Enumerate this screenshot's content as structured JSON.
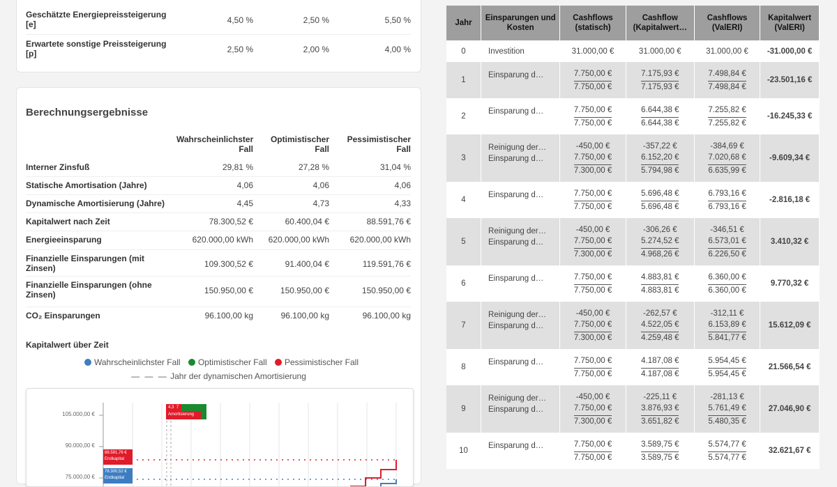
{
  "params": {
    "rows": [
      {
        "label": "Geschätzte Energiepreissteigerung [e]",
        "values": [
          "4,50 %",
          "2,50 %",
          "5,50 %"
        ]
      },
      {
        "label": "Erwartete sonstige Preissteigerung [p]",
        "values": [
          "2,50 %",
          "2,00 %",
          "4,00 %"
        ]
      }
    ]
  },
  "results": {
    "title": "Berechnungsergebnisse",
    "headers": [
      "Wahrscheinlichster Fall",
      "Optimistischer Fall",
      "Pessimistischer Fall"
    ],
    "rows": [
      {
        "label": "Interner Zinsfuß",
        "values": [
          "29,81 %",
          "27,28 %",
          "31,04 %"
        ]
      },
      {
        "label": "Statische Amortisation (Jahre)",
        "values": [
          "4,06",
          "4,06",
          "4,06"
        ]
      },
      {
        "label": "Dynamische Amortisierung (Jahre)",
        "values": [
          "4,45",
          "4,73",
          "4,33"
        ]
      },
      {
        "label": "Kapitalwert nach Zeit",
        "values": [
          "78.300,52 €",
          "60.400,04 €",
          "88.591,76 €"
        ]
      },
      {
        "label": "Energieeinsparung",
        "values": [
          "620.000,00 kWh",
          "620.000,00 kWh",
          "620.000,00 kWh"
        ]
      },
      {
        "label": "Finanzielle Einsparungen (mit Zinsen)",
        "values": [
          "109.300,52 €",
          "91.400,04 €",
          "119.591,76 €"
        ]
      },
      {
        "label": "Finanzielle Einsparungen (ohne Zinsen)",
        "values": [
          "150.950,00 €",
          "150.950,00 €",
          "150.950,00 €"
        ]
      },
      {
        "label": "CO₂ Einsparungen",
        "values": [
          "96.100,00 kg",
          "96.100,00 kg",
          "96.100,00 kg"
        ]
      }
    ]
  },
  "chart": {
    "title": "Kapitalwert über Zeit",
    "legend": [
      {
        "label": "Wahrscheinlichster Fall",
        "color": "#3d7ec3"
      },
      {
        "label": "Optimistischer Fall",
        "color": "#1a8a2e"
      },
      {
        "label": "Pessimistischer Fall",
        "color": "#e01b2a"
      }
    ],
    "legend_dash": "Jahr der dynamischen Amortisierung",
    "y_ticks": [
      "105.000,00 €",
      "90.000,00 €",
      "75.000,00 €"
    ],
    "flags": {
      "red_value": "88.591,76 €",
      "red_label": "Endkapital",
      "blue_value": "78.300,52 €",
      "blue_label": "Endkapital",
      "amort_label": "Amortisierung",
      "amort_year_red": "4,3",
      "amort_year_green": "7"
    }
  },
  "chart_data": {
    "type": "line",
    "title": "Kapitalwert über Zeit",
    "xlabel": "",
    "ylabel": "",
    "y_ticks": [
      105000,
      90000,
      75000
    ],
    "series": [
      {
        "name": "Wahrscheinlichster Fall",
        "final_value": 78300.52
      },
      {
        "name": "Optimistischer Fall",
        "final_value": 60400.04
      },
      {
        "name": "Pessimistischer Fall",
        "final_value": 88591.76
      }
    ],
    "legend": "top"
  },
  "cashflow": {
    "headers": [
      "Jahr",
      "Einsparungen und Kosten",
      "Cashflows (statisch)",
      "Cashflow (Kapitalwert…",
      "Cashflows (ValERI)",
      "Kapitalwert (ValERI)"
    ],
    "rows": [
      {
        "year": "0",
        "desc": [
          "Investition"
        ],
        "s": [
          "31.000,00 €"
        ],
        "k": [
          "31.000,00 €"
        ],
        "v": [
          "31.000,00 €"
        ],
        "kw": "-31.000,00 €",
        "neg": true,
        "single": true
      },
      {
        "year": "1",
        "desc": [
          "Einsparung d…"
        ],
        "s": [
          "7.750,00 €",
          "7.750,00 €"
        ],
        "k": [
          "7.175,93 €",
          "7.175,93 €"
        ],
        "v": [
          "7.498,84 €",
          "7.498,84 €"
        ],
        "kw": "-23.501,16 €",
        "neg": true
      },
      {
        "year": "2",
        "desc": [
          "Einsparung d…"
        ],
        "s": [
          "7.750,00 €",
          "7.750,00 €"
        ],
        "k": [
          "6.644,38 €",
          "6.644,38 €"
        ],
        "v": [
          "7.255,82 €",
          "7.255,82 €"
        ],
        "kw": "-16.245,33 €",
        "neg": true
      },
      {
        "year": "3",
        "desc": [
          "Reinigung der…",
          "Einsparung d…"
        ],
        "s": [
          "-450,00 €",
          "7.750,00 €",
          "7.300,00 €"
        ],
        "k": [
          "-357,22 €",
          "6.152,20 €",
          "5.794,98 €"
        ],
        "v": [
          "-384,69 €",
          "7.020,68 €",
          "6.635,99 €"
        ],
        "kw": "-9.609,34 €",
        "neg": true
      },
      {
        "year": "4",
        "desc": [
          "Einsparung d…"
        ],
        "s": [
          "7.750,00 €",
          "7.750,00 €"
        ],
        "k": [
          "5.696,48 €",
          "5.696,48 €"
        ],
        "v": [
          "6.793,16 €",
          "6.793,16 €"
        ],
        "kw": "-2.816,18 €",
        "neg": true
      },
      {
        "year": "5",
        "desc": [
          "Reinigung der…",
          "Einsparung d…"
        ],
        "s": [
          "-450,00 €",
          "7.750,00 €",
          "7.300,00 €"
        ],
        "k": [
          "-306,26 €",
          "5.274,52 €",
          "4.968,26 €"
        ],
        "v": [
          "-346,51 €",
          "6.573,01 €",
          "6.226,50 €"
        ],
        "kw": "3.410,32 €",
        "neg": false
      },
      {
        "year": "6",
        "desc": [
          "Einsparung d…"
        ],
        "s": [
          "7.750,00 €",
          "7.750,00 €"
        ],
        "k": [
          "4.883,81 €",
          "4.883,81 €"
        ],
        "v": [
          "6.360,00 €",
          "6.360,00 €"
        ],
        "kw": "9.770,32 €",
        "neg": false
      },
      {
        "year": "7",
        "desc": [
          "Reinigung der…",
          "Einsparung d…"
        ],
        "s": [
          "-450,00 €",
          "7.750,00 €",
          "7.300,00 €"
        ],
        "k": [
          "-262,57 €",
          "4.522,05 €",
          "4.259,48 €"
        ],
        "v": [
          "-312,11 €",
          "6.153,89 €",
          "5.841,77 €"
        ],
        "kw": "15.612,09 €",
        "neg": false
      },
      {
        "year": "8",
        "desc": [
          "Einsparung d…"
        ],
        "s": [
          "7.750,00 €",
          "7.750,00 €"
        ],
        "k": [
          "4.187,08 €",
          "4.187,08 €"
        ],
        "v": [
          "5.954,45 €",
          "5.954,45 €"
        ],
        "kw": "21.566,54 €",
        "neg": false
      },
      {
        "year": "9",
        "desc": [
          "Reinigung der…",
          "Einsparung d…"
        ],
        "s": [
          "-450,00 €",
          "7.750,00 €",
          "7.300,00 €"
        ],
        "k": [
          "-225,11 €",
          "3.876,93 €",
          "3.651,82 €"
        ],
        "v": [
          "-281,13 €",
          "5.761,49 €",
          "5.480,35 €"
        ],
        "kw": "27.046,90 €",
        "neg": false
      },
      {
        "year": "10",
        "desc": [
          "Einsparung d…"
        ],
        "s": [
          "7.750,00 €",
          "7.750,00 €"
        ],
        "k": [
          "3.589,75 €",
          "3.589,75 €"
        ],
        "v": [
          "5.574,77 €",
          "5.574,77 €"
        ],
        "kw": "32.621,67 €",
        "neg": false
      }
    ]
  }
}
